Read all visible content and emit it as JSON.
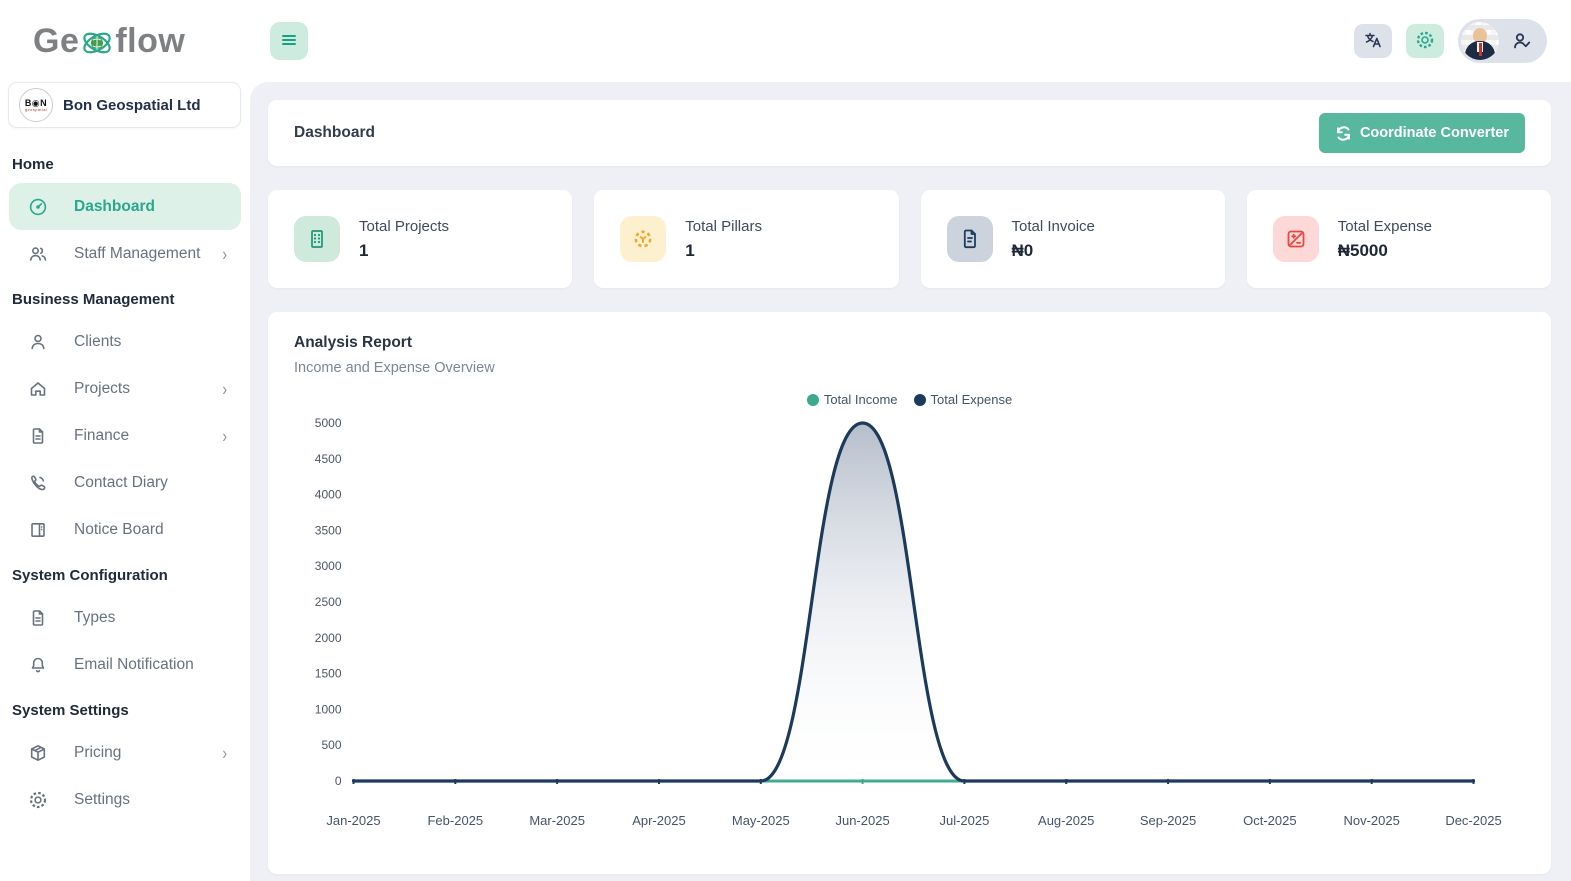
{
  "brand": {
    "logo_part1": "Ge",
    "logo_part2": "flow",
    "logo_icon": "atom-globe-icon"
  },
  "company": {
    "name": "Bon Geospatial Ltd",
    "logo_line1": "B◉N",
    "logo_line2": "geospatial"
  },
  "topbar": {
    "buttons": [
      {
        "name": "language-button",
        "icon": "translate-icon"
      },
      {
        "name": "settings-button",
        "icon": "gear-icon"
      },
      {
        "name": "account-button",
        "icon": "person-check-icon"
      }
    ]
  },
  "sidebar": {
    "sections": [
      {
        "title": "Home",
        "items": [
          {
            "label": "Dashboard",
            "icon": "gauge-icon",
            "active": true,
            "chevron": false
          },
          {
            "label": "Staff Management",
            "icon": "people-icon",
            "active": false,
            "chevron": true
          }
        ]
      },
      {
        "title": "Business Management",
        "items": [
          {
            "label": "Clients",
            "icon": "person-icon",
            "active": false,
            "chevron": false
          },
          {
            "label": "Projects",
            "icon": "home-icon",
            "active": false,
            "chevron": true
          },
          {
            "label": "Finance",
            "icon": "document-icon",
            "active": false,
            "chevron": true
          },
          {
            "label": "Contact Diary",
            "icon": "phone-icon",
            "active": false,
            "chevron": false
          },
          {
            "label": "Notice Board",
            "icon": "board-icon",
            "active": false,
            "chevron": false
          }
        ]
      },
      {
        "title": "System Configuration",
        "items": [
          {
            "label": "Types",
            "icon": "document-icon",
            "active": false,
            "chevron": false
          },
          {
            "label": "Email Notification",
            "icon": "bell-icon",
            "active": false,
            "chevron": false
          }
        ]
      },
      {
        "title": "System Settings",
        "items": [
          {
            "label": "Pricing",
            "icon": "package-icon",
            "active": false,
            "chevron": true
          },
          {
            "label": "Settings",
            "icon": "gear-icon",
            "active": false,
            "chevron": false
          }
        ]
      }
    ]
  },
  "page": {
    "title": "Dashboard",
    "converter_button_label": "Coordinate Converter",
    "converter_button_icon": "sync-icon",
    "converter_button_color": "#58b89e"
  },
  "stats": [
    {
      "label": "Total Projects",
      "value": "1",
      "icon": "building-icon",
      "icon_bg": "#cfeadd",
      "icon_color": "#1c9578"
    },
    {
      "label": "Total Pillars",
      "value": "1",
      "icon": "pillars-icon",
      "icon_bg": "#fdf0cf",
      "icon_color": "#eda92b"
    },
    {
      "label": "Total Invoice",
      "value": "₦0",
      "icon": "invoice-icon",
      "icon_bg": "#ccd3dd",
      "icon_color": "#1c3c5e"
    },
    {
      "label": "Total Expense",
      "value": "₦5000",
      "icon": "calculator-icon",
      "icon_bg": "#fcd8d7",
      "icon_color": "#e8483f"
    }
  ],
  "report": {
    "title": "Analysis Report",
    "subtitle": "Income and Expense Overview"
  },
  "chart_data": {
    "type": "area",
    "title": "Income and Expense Overview",
    "x": [
      "Jan-2025",
      "Feb-2025",
      "Mar-2025",
      "Apr-2025",
      "May-2025",
      "Jun-2025",
      "Jul-2025",
      "Aug-2025",
      "Sep-2025",
      "Oct-2025",
      "Nov-2025",
      "Dec-2025"
    ],
    "series": [
      {
        "name": "Total Income",
        "color": "#3aa98d",
        "values": [
          0,
          0,
          0,
          0,
          0,
          0,
          0,
          0,
          0,
          0,
          0,
          0
        ]
      },
      {
        "name": "Total Expense",
        "color": "#1b3a5c",
        "values": [
          0,
          0,
          0,
          0,
          0,
          5000,
          0,
          0,
          0,
          0,
          0,
          0
        ]
      }
    ],
    "ylim": [
      0,
      5000
    ],
    "ytick_step": 500,
    "grid": false,
    "smooth": true,
    "fill": "gradient-under-expense",
    "legend_position": "top-center"
  }
}
